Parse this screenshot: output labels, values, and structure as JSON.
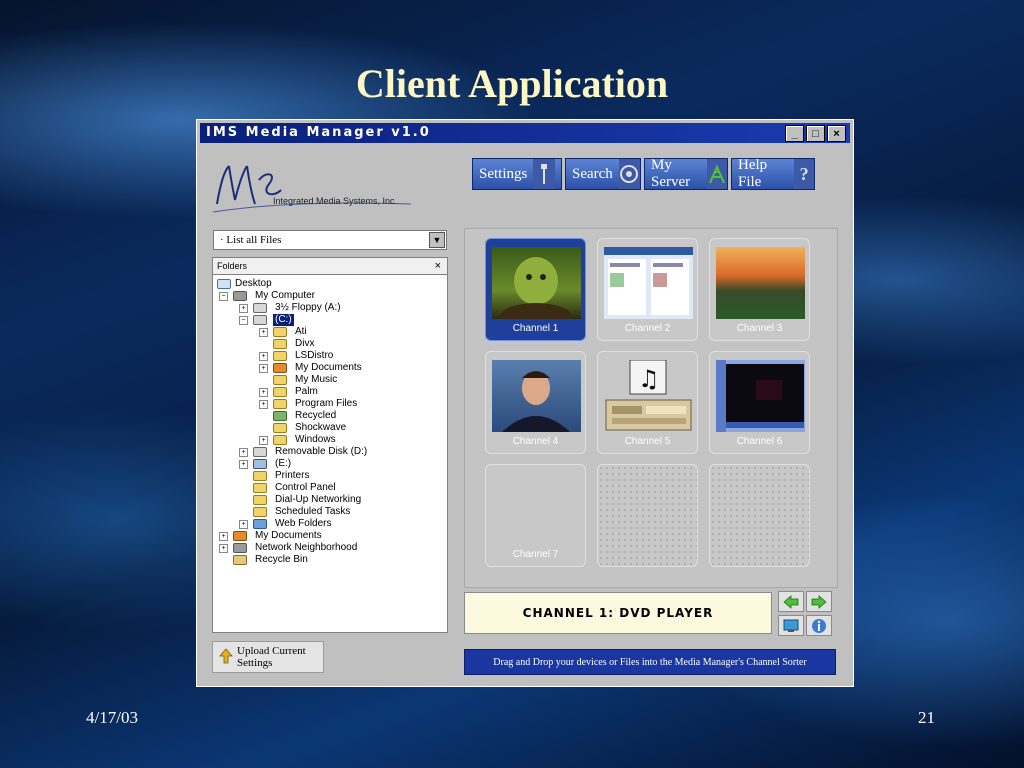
{
  "slide": {
    "title": "Client Application",
    "date": "4/17/03",
    "page_number": "21"
  },
  "window": {
    "title": "IMS Media Manager v1.0",
    "controls": {
      "minimize": "_",
      "maximize": "□",
      "close": "×"
    }
  },
  "logo": {
    "text": "Integrated Media Systems, Inc."
  },
  "toolbar": {
    "settings_label": "Settings",
    "search_label": "Search",
    "my_server_label": "My Server",
    "help_label": "Help File"
  },
  "filter": {
    "selected": "·  List all Files"
  },
  "folders": {
    "header": "Folders",
    "close": "×",
    "items": [
      "Desktop",
      "My Computer",
      "3½ Floppy (A:)",
      "(C:)",
      "Ati",
      "Divx",
      "LSDistro",
      "My Documents",
      "My Music",
      "Palm",
      "Program Files",
      "Recycled",
      "Shockwave",
      "Windows",
      "Removable Disk (D:)",
      "(E:)",
      "Printers",
      "Control Panel",
      "Dial-Up Networking",
      "Scheduled Tasks",
      "Web Folders",
      "My Documents",
      "Network Neighborhood",
      "Recycle Bin"
    ]
  },
  "upload_button": "Upload Current Settings",
  "channels": [
    "Channel 1",
    "Channel 2",
    "Channel 3",
    "Channel 4",
    "Channel 5",
    "Channel 6",
    "Channel 7"
  ],
  "status": "CHANNEL 1: DVD PLAYER",
  "hint": "Drag and Drop your devices or Files into the Media Manager's Channel Sorter",
  "colors": {
    "title_text": "#fdf7c3",
    "window_title_bar": "#0a1f7a",
    "toolbar_button": "#3c5aa8",
    "active_tile": "#1e3f9a",
    "hint_bar": "#1a36a0"
  }
}
